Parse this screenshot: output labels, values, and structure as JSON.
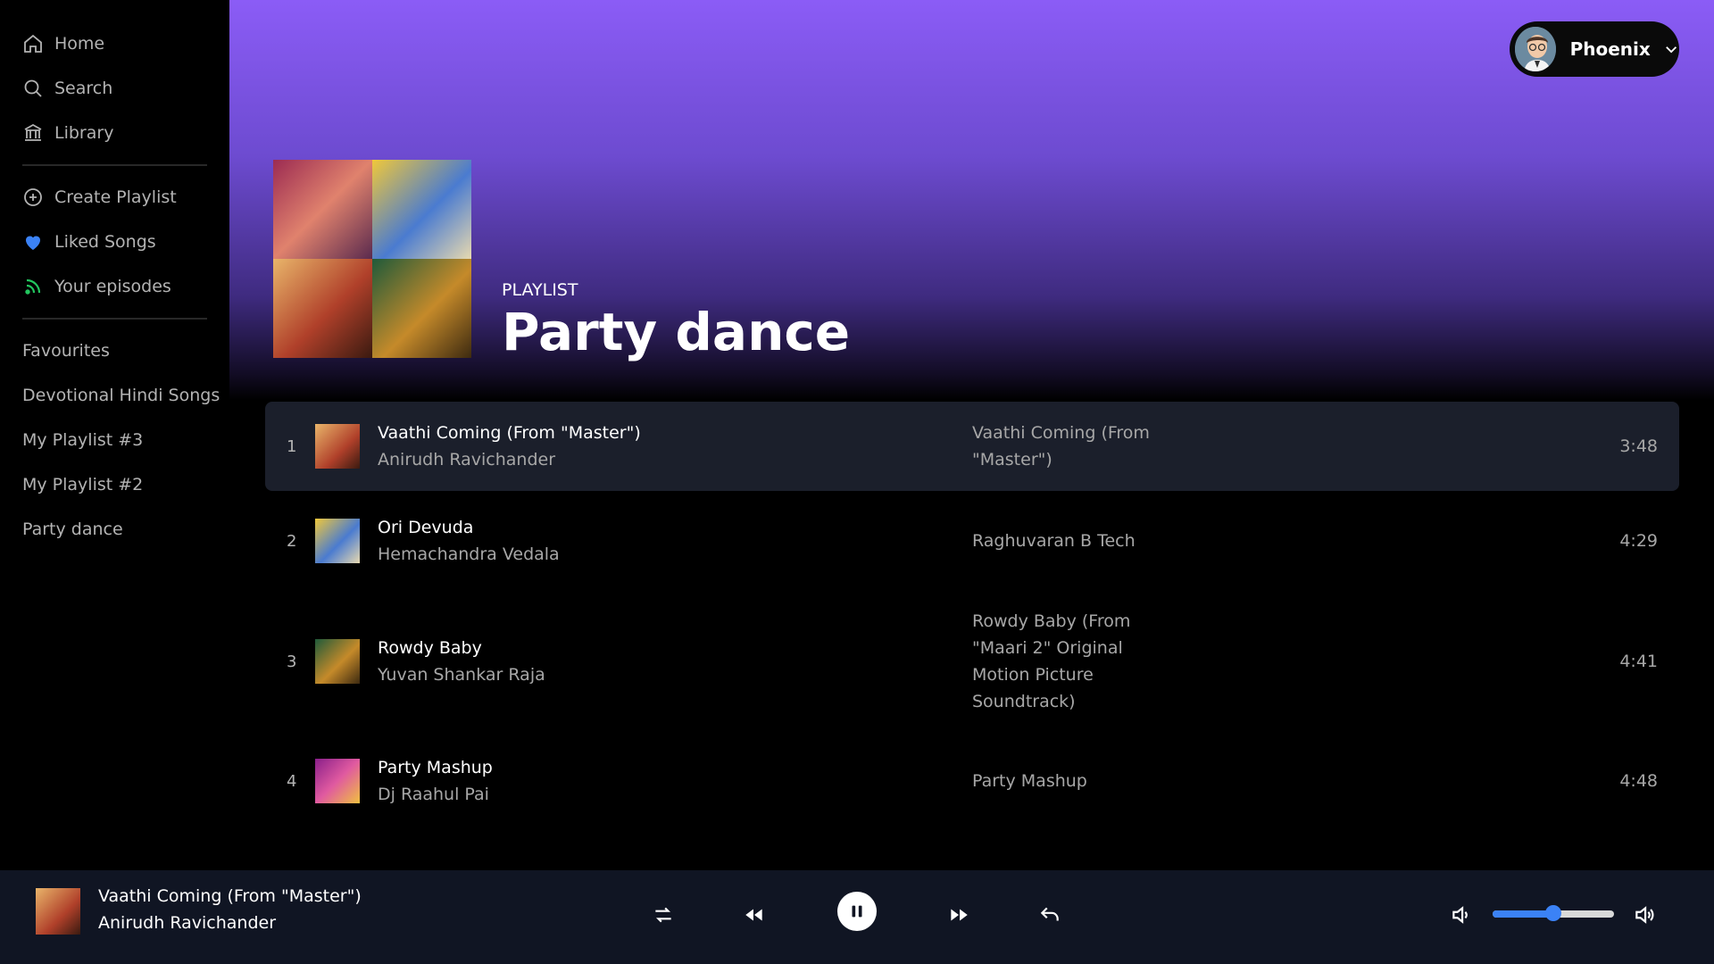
{
  "sidebar": {
    "nav": [
      {
        "label": "Home",
        "icon": "home-icon"
      },
      {
        "label": "Search",
        "icon": "search-icon"
      },
      {
        "label": "Library",
        "icon": "library-icon"
      }
    ],
    "actions": [
      {
        "label": "Create Playlist",
        "icon": "plus-circle-icon"
      },
      {
        "label": "Liked Songs",
        "icon": "heart-icon"
      },
      {
        "label": "Your episodes",
        "icon": "rss-icon"
      }
    ],
    "playlists": [
      "Favourites",
      "Devotional Hindi Songs",
      "My Playlist #3",
      "My Playlist #2",
      "Party dance"
    ]
  },
  "user": {
    "name": "Phoenix"
  },
  "playlist": {
    "type": "PLAYLIST",
    "title": "Party dance"
  },
  "tracks": [
    {
      "num": "1",
      "title": "Vaathi Coming (From \"Master\")",
      "artist": "Anirudh Ravichander",
      "album": "Vaathi Coming (From \"Master\")",
      "duration": "3:48"
    },
    {
      "num": "2",
      "title": "Ori Devuda",
      "artist": "Hemachandra Vedala",
      "album": "Raghuvaran B Tech",
      "duration": "4:29"
    },
    {
      "num": "3",
      "title": "Rowdy Baby",
      "artist": "Yuvan Shankar Raja",
      "album": "Rowdy Baby (From \"Maari 2\" Original Motion Picture Soundtrack)",
      "duration": "4:41"
    },
    {
      "num": "4",
      "title": "Party Mashup",
      "artist": "Dj Raahul Pai",
      "album": "Party Mashup",
      "duration": "4:48"
    }
  ],
  "now_playing": {
    "title": "Vaathi Coming (From \"Master\")",
    "artist": "Anirudh Ravichander"
  },
  "volume": 0.5,
  "colors": {
    "accent": "#3b82f6",
    "header_gradient_top": "#8b5cf6",
    "active_row": "#1b1f2b",
    "player_bg": "#101523",
    "liked_heart": "#3b82f6",
    "episodes_green": "#22c55e"
  }
}
